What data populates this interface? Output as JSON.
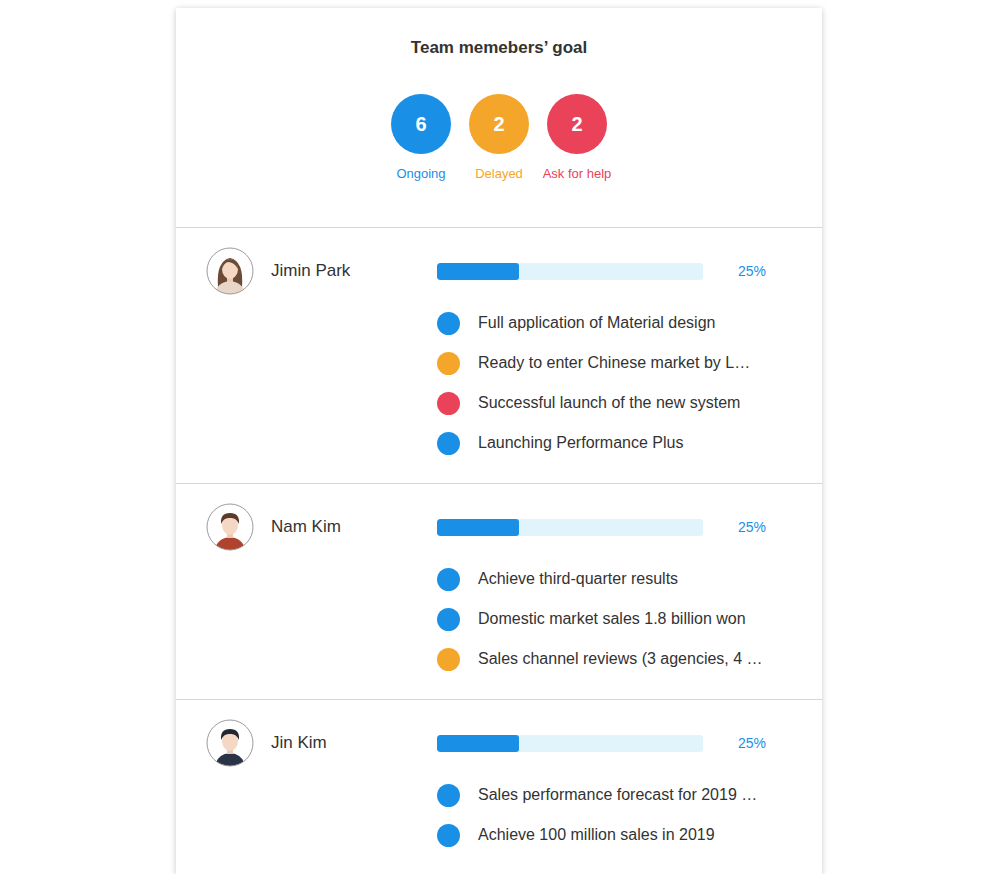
{
  "title": "Team memebers’ goal",
  "summary": [
    {
      "count": "6",
      "label": "Ongoing",
      "color": "#1a8fe6"
    },
    {
      "count": "2",
      "label": "Delayed",
      "color": "#f4a62a"
    },
    {
      "count": "2",
      "label": "Ask for help",
      "color": "#ea4258"
    }
  ],
  "members": [
    {
      "name": "Jimin Park",
      "level": 0.31,
      "percent": "25%",
      "goals": [
        {
          "text": "Full application of Material design",
          "color": "#1a8fe6"
        },
        {
          "text": "Ready to enter Chinese market by L…",
          "color": "#f4a62a"
        },
        {
          "text": "Successful launch of the new system",
          "color": "#ea4258"
        },
        {
          "text": "Launching Performance Plus",
          "color": "#1a8fe6"
        }
      ]
    },
    {
      "name": "Nam Kim",
      "level": 0.31,
      "percent": "25%",
      "goals": [
        {
          "text": "Achieve third-quarter results",
          "color": "#1a8fe6"
        },
        {
          "text": "Domestic market sales 1.8 billion won",
          "color": "#1a8fe6"
        },
        {
          "text": "Sales channel reviews (3 agencies, 4 …",
          "color": "#f4a62a"
        }
      ]
    },
    {
      "name": "Jin Kim",
      "level": 0.31,
      "percent": "25%",
      "goals": [
        {
          "text": "Sales performance forecast for 2019 …",
          "color": "#1a8fe6"
        },
        {
          "text": "Achieve 100 million sales in 2019",
          "color": "#1a8fe6"
        }
      ]
    }
  ]
}
